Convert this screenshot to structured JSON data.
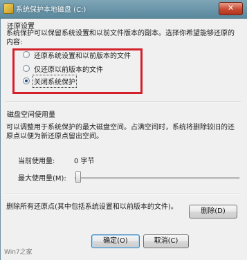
{
  "window": {
    "title": "系统保护本地磁盘 (C:)",
    "close_label": "✕"
  },
  "restore_settings": {
    "heading": "还原设置",
    "description": "系统保护可以保留系统设置和以前文件版本的副本。选择你希望能够还原的内容:",
    "options": [
      {
        "label": "还原系统设置和以前版本的文件",
        "checked": false
      },
      {
        "label": "仅还原以前版本的文件",
        "checked": false
      },
      {
        "label": "关闭系统保护",
        "checked": true
      }
    ]
  },
  "disk_usage": {
    "heading": "磁盘空间使用量",
    "description": "可以调整用于系统保护的最大磁盘空间。占满空间时，系统将删除较旧的还原点以便为新还原点留出空间。",
    "current_label": "当前使用量:",
    "current_value": "0 字节",
    "max_label": "最大使用量(M):",
    "max_fraction": 0.0
  },
  "delete": {
    "description": "删除所有还原点(其中包括系统设置和以前版本的文件)。",
    "button_label": "删除(D)"
  },
  "footer": {
    "ok_label": "确定(O)",
    "cancel_label": "取消(C)",
    "corner_text": "Win7之家"
  },
  "colors": {
    "highlight_box": "#d3202a",
    "titlebar": "#6e98ab"
  }
}
